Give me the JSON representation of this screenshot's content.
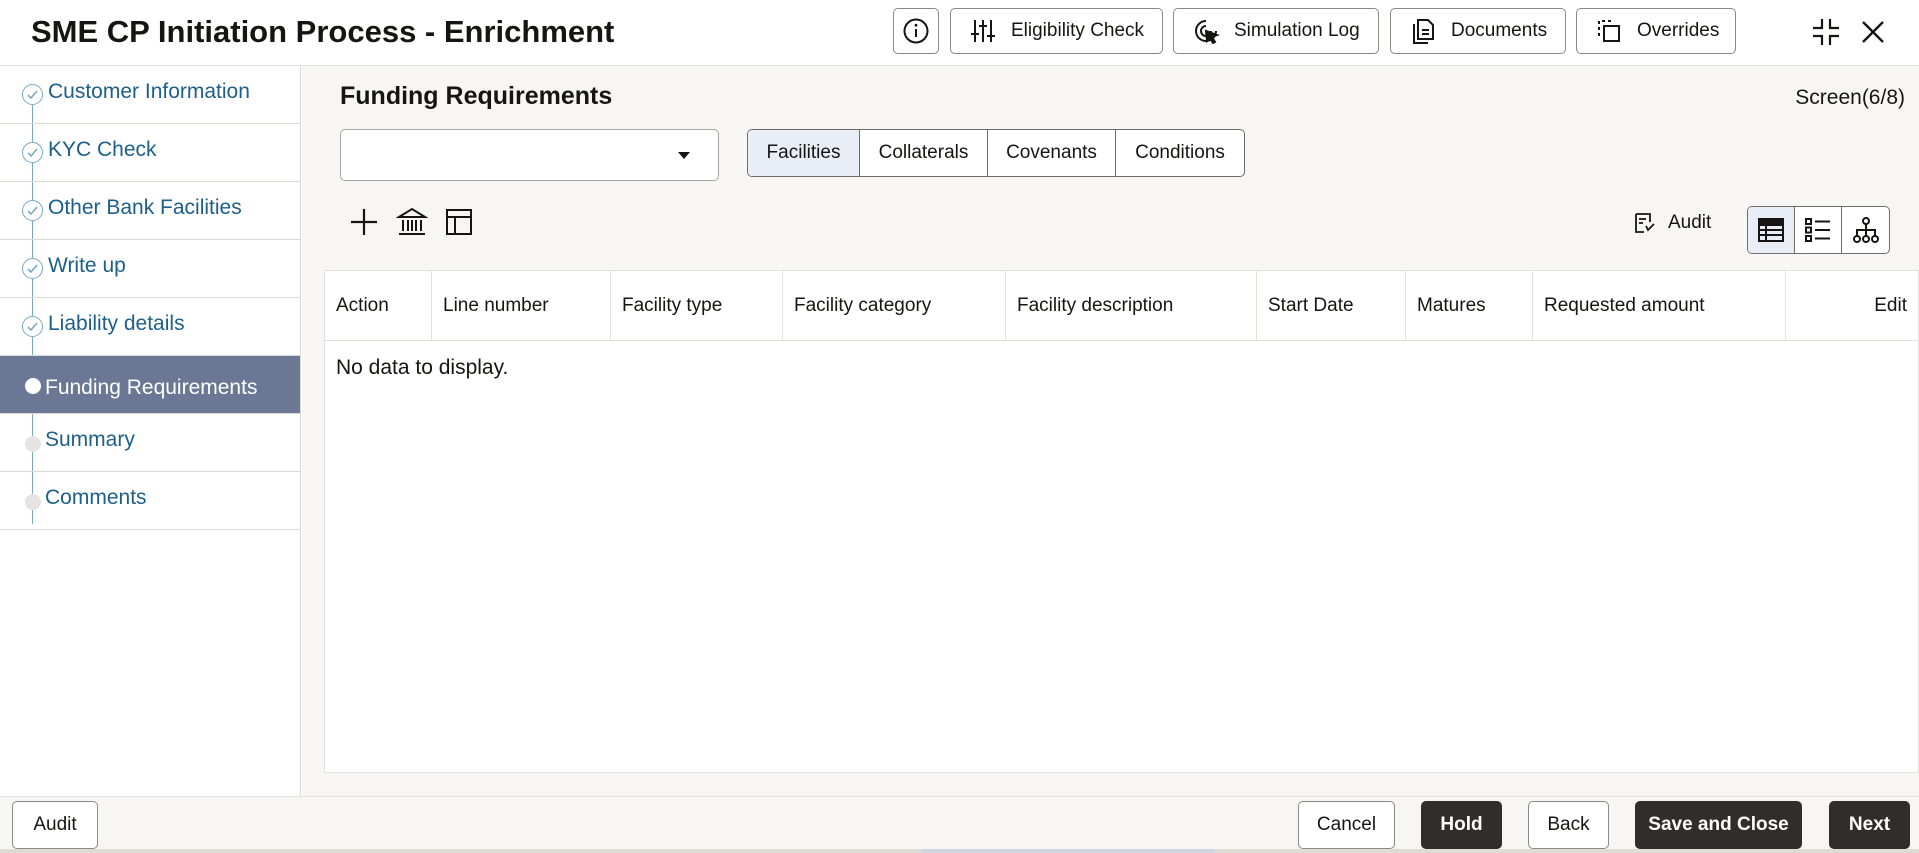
{
  "header": {
    "title": "SME CP Initiation Process - Enrichment",
    "buttons": {
      "eligibility": "Eligibility Check",
      "simulation": "Simulation Log",
      "documents": "Documents",
      "overrides": "Overrides"
    },
    "icons": [
      "info-icon",
      "sliders-icon",
      "cursor-click-icon",
      "document-icon",
      "overrides-icon",
      "collapse-icon",
      "close-icon"
    ]
  },
  "sidebar": {
    "items": [
      {
        "label": "Customer Information",
        "status": "completed"
      },
      {
        "label": "KYC Check",
        "status": "completed"
      },
      {
        "label": "Other Bank Facilities",
        "status": "completed"
      },
      {
        "label": "Write up",
        "status": "completed"
      },
      {
        "label": "Liability details",
        "status": "completed"
      },
      {
        "label": "Funding Requirements",
        "status": "active"
      },
      {
        "label": "Summary",
        "status": "pending"
      },
      {
        "label": "Comments",
        "status": "pending"
      }
    ]
  },
  "main": {
    "title": "Funding Requirements",
    "screen_counter": "Screen(6/8)",
    "select_value": "",
    "tabs": [
      "Facilities",
      "Collaterals",
      "Covenants",
      "Conditions"
    ],
    "selected_tab": "Facilities",
    "audit_label": "Audit",
    "toolbar_icons": [
      "add-icon",
      "bank-icon",
      "layout-icon"
    ],
    "view_icons": [
      "table-view-icon",
      "list-view-icon",
      "hierarchy-view-icon"
    ],
    "grid": {
      "columns": [
        "Action",
        "Line number",
        "Facility type",
        "Facility category",
        "Facility description",
        "Start Date",
        "Matures",
        "Requested amount",
        "Edit"
      ],
      "empty_text": "No data to display."
    }
  },
  "footer": {
    "audit": "Audit",
    "cancel": "Cancel",
    "hold": "Hold",
    "back": "Back",
    "save_close": "Save and Close",
    "next": "Next"
  },
  "colors": {
    "active_step_bg": "#6a7895",
    "link_text": "#1b5f8a",
    "primary_button": "#312d2a",
    "selected_tab_bg": "#e9eef6"
  }
}
